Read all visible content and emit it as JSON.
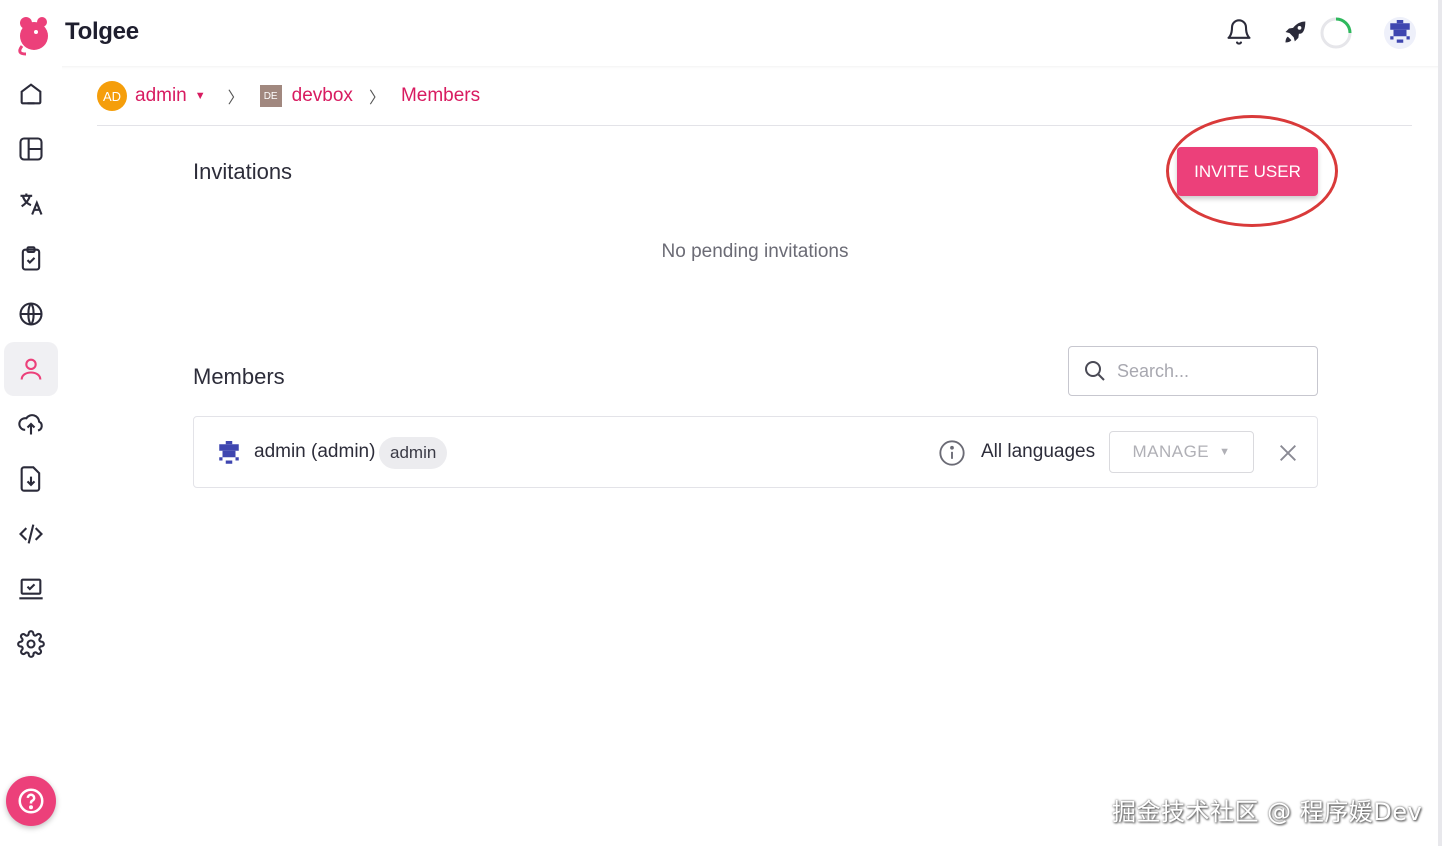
{
  "app": {
    "brand": "Tolgee"
  },
  "breadcrumb": {
    "org_avatar": "AD",
    "org": "admin",
    "project_badge": "DE",
    "project": "devbox",
    "current": "Members"
  },
  "invitations": {
    "title": "Invitations",
    "invite_button": "INVITE USER",
    "empty": "No pending invitations"
  },
  "members": {
    "title": "Members",
    "search_placeholder": "Search...",
    "rows": [
      {
        "name": "admin (admin)",
        "role": "admin",
        "languages": "All languages",
        "manage": "MANAGE"
      }
    ]
  },
  "watermark": "掘金技术社区 @ 程序媛Dev",
  "colors": {
    "accent": "#ec407a",
    "accent_text": "#d81b60",
    "annotation": "#d93a3a"
  },
  "sidebar": {
    "items": [
      "home-icon",
      "dashboard-icon",
      "translate-icon",
      "tasks-icon",
      "languages-icon",
      "members-icon",
      "import-icon",
      "export-icon",
      "integrate-icon",
      "monitor-icon",
      "settings-icon"
    ],
    "active": "members-icon"
  }
}
